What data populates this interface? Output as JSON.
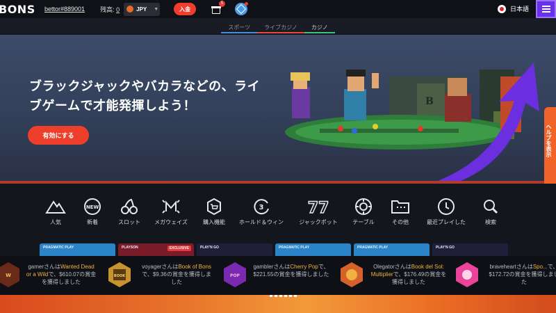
{
  "header": {
    "logo": "BONS",
    "username": "bettor#889001",
    "balance_label": "残高: ",
    "balance_value": "0",
    "currency": "JPY",
    "deposit_label": "入金",
    "gift_badge": "5",
    "language": "日本語"
  },
  "category_tabs": [
    {
      "label": "スポーツ"
    },
    {
      "label": "ライブカジノ"
    },
    {
      "label": "カジノ"
    }
  ],
  "hero": {
    "title": "ブラックジャックやバカラなどの、ライブゲームで才能発揮しよう！",
    "cta_label": "有効にする"
  },
  "side_tab": {
    "label": "ヘルプを表示"
  },
  "game_categories": [
    {
      "label": "人気",
      "icon": "mountain-icon"
    },
    {
      "label": "新着",
      "icon": "new-badge-icon"
    },
    {
      "label": "スロット",
      "icon": "cherries-icon"
    },
    {
      "label": "メガウェイズ",
      "icon": "megaways-icon"
    },
    {
      "label": "購入機能",
      "icon": "cart-icon"
    },
    {
      "label": "ホールド＆ウィン",
      "icon": "hold-win-icon"
    },
    {
      "label": "ジャックポット",
      "icon": "seven-icon"
    },
    {
      "label": "テーブル",
      "icon": "chip-icon"
    },
    {
      "label": "その他",
      "icon": "folder-icon"
    },
    {
      "label": "最近プレイした",
      "icon": "clock-icon"
    },
    {
      "label": "検索",
      "icon": "search-icon"
    }
  ],
  "game_cards": [
    {
      "provider": "PRAGMATIC PLAY",
      "badge": ""
    },
    {
      "provider": "PLAYSON",
      "badge": "EXCLUSIVE"
    },
    {
      "provider": "PLAY'N GO",
      "badge": ""
    },
    {
      "provider": "PRAGMATIC PLAY",
      "badge": ""
    },
    {
      "provider": "PRAGMATIC PLAY",
      "badge": ""
    },
    {
      "provider": "PLAY'N GO",
      "badge": ""
    }
  ],
  "winners": [
    {
      "user": "gamerさんは",
      "game": "Wanted Dead or a Wild",
      "text": "で、$610.07の賞金を獲得しました"
    },
    {
      "user": "voyagerさんは",
      "game": "Book of Bons",
      "text": "で、$9.36の賞金を獲得しました"
    },
    {
      "user": "gamblerさんは",
      "game": "Cherry Pop",
      "text": "で、$221.55の賞金を獲得しました"
    },
    {
      "user": "Olegatorさんは",
      "game": "Book del Sol: Multiplier",
      "text": "で、$176.49の賞金を獲得しました"
    },
    {
      "user": "braveheartさんは",
      "game": "Spo...",
      "text": "で、$172.72の賞金を獲得しました"
    }
  ],
  "colors": {
    "accent_red": "#ee3e2c",
    "menu_purple": "#6a32e6",
    "winner_game": "#f0b341",
    "side_tab": "#f2632a"
  }
}
